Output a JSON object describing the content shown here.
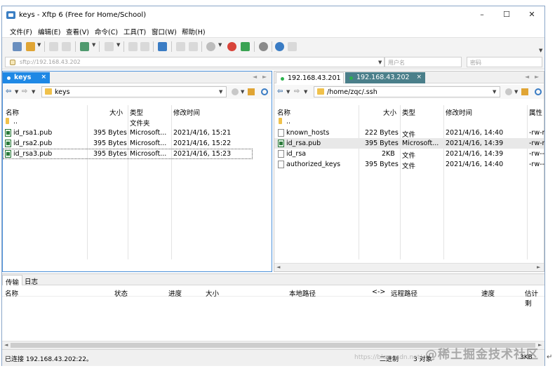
{
  "window": {
    "title": "keys - Xftp 6 (Free for Home/School)",
    "minimize": "–",
    "maximize": "☐",
    "close": "✕"
  },
  "menu": [
    "文件(F)",
    "编辑(E)",
    "查看(V)",
    "命令(C)",
    "工具(T)",
    "窗口(W)",
    "帮助(H)"
  ],
  "address": {
    "value": "sftp://192.168.43.202",
    "user_placeholder": "用户名",
    "pass_placeholder": "密码"
  },
  "left_pane": {
    "tab": {
      "label": "keys",
      "close": "×"
    },
    "path": "keys",
    "columns": {
      "name": "名称",
      "size": "大小",
      "type": "类型",
      "modified": "修改时间"
    },
    "rows": [
      {
        "name": "..",
        "size": "",
        "type": "文件夹",
        "modified": "",
        "icon": "folder"
      },
      {
        "name": "id_rsa1.pub",
        "size": "395 Bytes",
        "type": "Microsoft...",
        "modified": "2021/4/16, 15:21",
        "icon": "pub"
      },
      {
        "name": "id_rsa2.pub",
        "size": "395 Bytes",
        "type": "Microsoft...",
        "modified": "2021/4/16, 15:22",
        "icon": "pub"
      },
      {
        "name": "id_rsa3.pub",
        "size": "395 Bytes",
        "type": "Microsoft...",
        "modified": "2021/4/16, 15:23",
        "icon": "pub"
      }
    ]
  },
  "right_pane": {
    "tabs": [
      {
        "label": "192.168.43.201",
        "dot": "#2bb24c"
      },
      {
        "label": "192.168.43.202",
        "dot": "#2bb24c",
        "close": "×"
      }
    ],
    "path": "/home/zqc/.ssh",
    "columns": {
      "name": "名称",
      "size": "大小",
      "type": "类型",
      "modified": "修改时间",
      "attr": "属性"
    },
    "rows": [
      {
        "name": "..",
        "size": "",
        "type": "",
        "modified": "",
        "attr": "",
        "icon": "folder"
      },
      {
        "name": "known_hosts",
        "size": "222 Bytes",
        "type": "文件",
        "modified": "2021/4/16, 14:40",
        "attr": "-rw-r",
        "icon": "file"
      },
      {
        "name": "id_rsa.pub",
        "size": "395 Bytes",
        "type": "Microsoft...",
        "modified": "2021/4/16, 14:39",
        "attr": "-rw-r",
        "icon": "pub"
      },
      {
        "name": "id_rsa",
        "size": "2KB",
        "type": "文件",
        "modified": "2021/4/16, 14:39",
        "attr": "-rw---",
        "icon": "file"
      },
      {
        "name": "authorized_keys",
        "size": "395 Bytes",
        "type": "文件",
        "modified": "2021/4/16, 14:40",
        "attr": "-rw---",
        "icon": "file"
      }
    ]
  },
  "transfer": {
    "tabs": [
      "传输",
      "日志"
    ],
    "columns": [
      "名称",
      "状态",
      "进度",
      "大小",
      "本地路径",
      "<->",
      "远程路径",
      "速度",
      "估计剩"
    ]
  },
  "status": {
    "connected": "已连接 192.168.43.202:22。",
    "mode": "二进制",
    "objects": "3 对象",
    "size": "3KB"
  },
  "watermark": {
    "text": "@稀土掘金技术社区",
    "url": "https://blog.csdn.net/..."
  },
  "colors": {
    "active_tab": "#1e88e5",
    "inactive_tab": "#4a7f8a",
    "connected_dot": "#2bb24c",
    "pub_icon": "#2b7a3b"
  }
}
